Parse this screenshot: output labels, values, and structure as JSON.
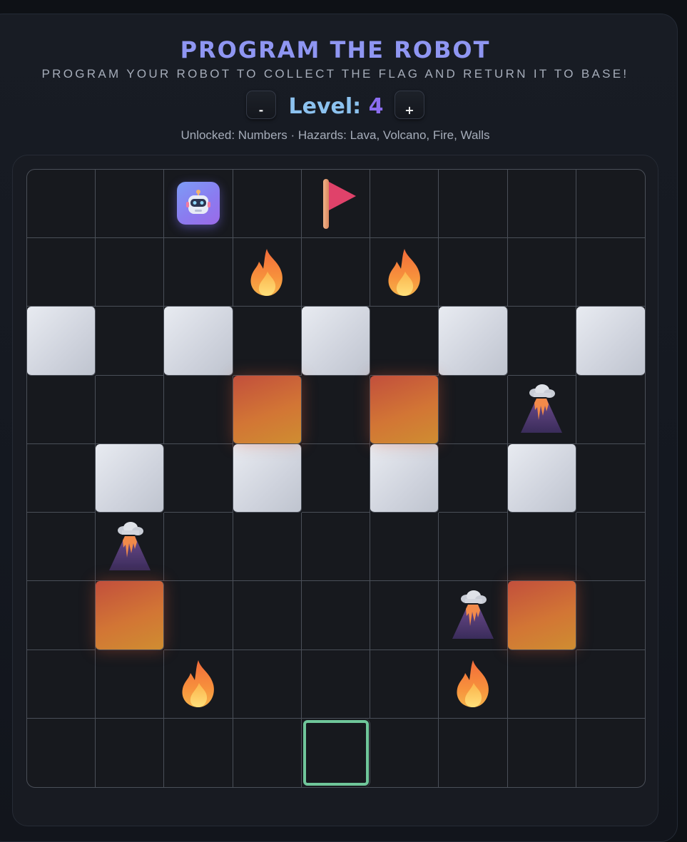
{
  "header": {
    "title": "PROGRAM THE ROBOT",
    "subtitle": "PROGRAM YOUR ROBOT TO COLLECT THE FLAG AND RETURN IT TO BASE!",
    "level_label": "Level:",
    "level_value": "4",
    "decrease_label": "-",
    "increase_label": "+",
    "info": "Unlocked: Numbers · Hazards: Lava, Volcano, Fire, Walls"
  },
  "board": {
    "rows": 9,
    "cols": 9,
    "cells": [
      [
        "empty",
        "empty",
        "robot",
        "empty",
        "flag",
        "empty",
        "empty",
        "empty",
        "empty"
      ],
      [
        "empty",
        "empty",
        "empty",
        "fire",
        "empty",
        "fire",
        "empty",
        "empty",
        "empty"
      ],
      [
        "wall",
        "empty",
        "wall",
        "empty",
        "wall",
        "empty",
        "wall",
        "empty",
        "wall"
      ],
      [
        "empty",
        "empty",
        "empty",
        "lava",
        "empty",
        "lava",
        "empty",
        "volcano",
        "empty"
      ],
      [
        "empty",
        "wall",
        "empty",
        "wall",
        "empty",
        "wall",
        "empty",
        "wall",
        "empty"
      ],
      [
        "empty",
        "volcano",
        "empty",
        "empty",
        "empty",
        "empty",
        "empty",
        "empty",
        "empty"
      ],
      [
        "empty",
        "lava",
        "empty",
        "empty",
        "empty",
        "empty",
        "volcano",
        "lava",
        "empty"
      ],
      [
        "empty",
        "empty",
        "fire",
        "empty",
        "empty",
        "empty",
        "fire",
        "empty",
        "empty"
      ],
      [
        "empty",
        "empty",
        "empty",
        "empty",
        "base",
        "empty",
        "empty",
        "empty",
        "empty"
      ]
    ]
  },
  "icons": {
    "robot": "robot-icon",
    "flag": "flag-icon",
    "fire": "fire-icon",
    "volcano": "volcano-icon"
  },
  "colors": {
    "title": "#8f96f2",
    "level_label": "#8cc2ef",
    "level_value": "#8b6df0",
    "base_outline": "#6fc69a",
    "lava": "#d27535",
    "wall": "#dde0e8",
    "flag": "#e0426a"
  }
}
